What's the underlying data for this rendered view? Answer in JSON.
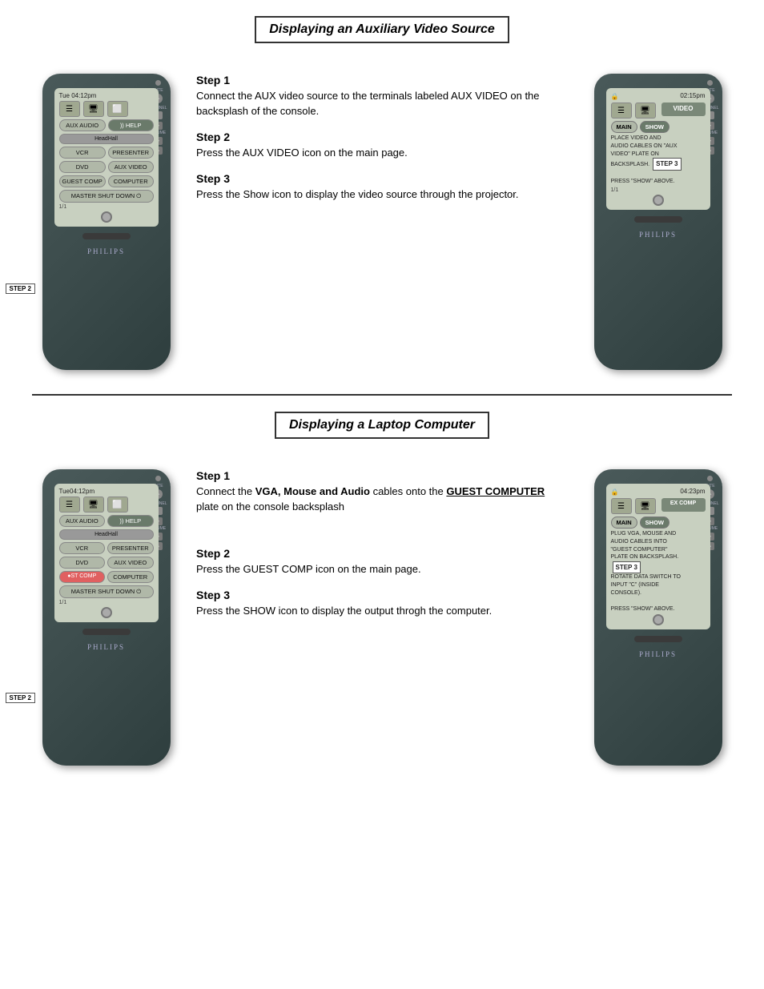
{
  "section1": {
    "title": "Displaying an Auxiliary Video Source",
    "step1_title": "Step 1",
    "step1_text": "Connect the AUX video source to the terminals labeled AUX VIDEO on the backsplash of the console.",
    "step2_title": "Step 2",
    "step2_text": "Press the AUX VIDEO icon on the main page.",
    "step3_title": "Step 3",
    "step3_text": "Press the Show icon to display the video source through the projector.",
    "device1": {
      "time": "Tue 04:12pm",
      "buttons": [
        "AUX AUDIO",
        "HELP",
        "HeadHall",
        "VCR",
        "PRESENTER",
        "DVD",
        "AUX VIDEO",
        "GUEST COMP",
        "COMPUTER",
        "MASTER SHUT DOWN"
      ],
      "page": "1/1"
    },
    "device2": {
      "time": "02:15pm",
      "mode": "VIDEO",
      "instructions": "PLACE VIDEO AND AUDIO CABLES ON \"AUX VIDEO\" PLATE ON BACKSPLASH.\n\nPRESS \"SHOW\" ABOVE.",
      "page": "1/1",
      "step_label": "STEP 3"
    }
  },
  "section2": {
    "title": "Displaying a Laptop Computer",
    "step1_title": "Step 1",
    "step1_text_prefix": "Connect the ",
    "step1_bold": "VGA, Mouse and Audio",
    "step1_mid": " cables onto the ",
    "step1_underline_bold": "GUEST COMPUTER",
    "step1_suffix": " plate on the console backsplash",
    "step2_title": "Step 2",
    "step2_text": "Press the GUEST COMP icon on the main page.",
    "step3_title": "Step 3",
    "step3_text": "Press the SHOW icon  to display the output throgh the computer.",
    "device1": {
      "time": "Tue04:12pm",
      "buttons": [
        "AUX AUDIO",
        "HELP",
        "HeadHall",
        "VCR",
        "PRESENTER",
        "DVD",
        "AUX VIDEO",
        "GUEST COMP",
        "COMPUTER",
        "MASTER SHUT DOWN"
      ],
      "page": "1/1",
      "step2_label": "STEP 2"
    },
    "device2": {
      "time": "04:23pm",
      "mode": "EX COMP",
      "instructions": "PLUG VGA, MOUSE AND AUDIO CABLES INTO \"GUEST COMPUTER\" PLATE ON BACKSPLASH. ROTATE DATA SWITCH TO INPUT \"C\" (INSIDE CONSOLE).\n\nPRESS \"SHOW\" ABOVE.",
      "page": "1/1",
      "step_label": "STEP 3"
    }
  },
  "philips": "PHILIPS"
}
